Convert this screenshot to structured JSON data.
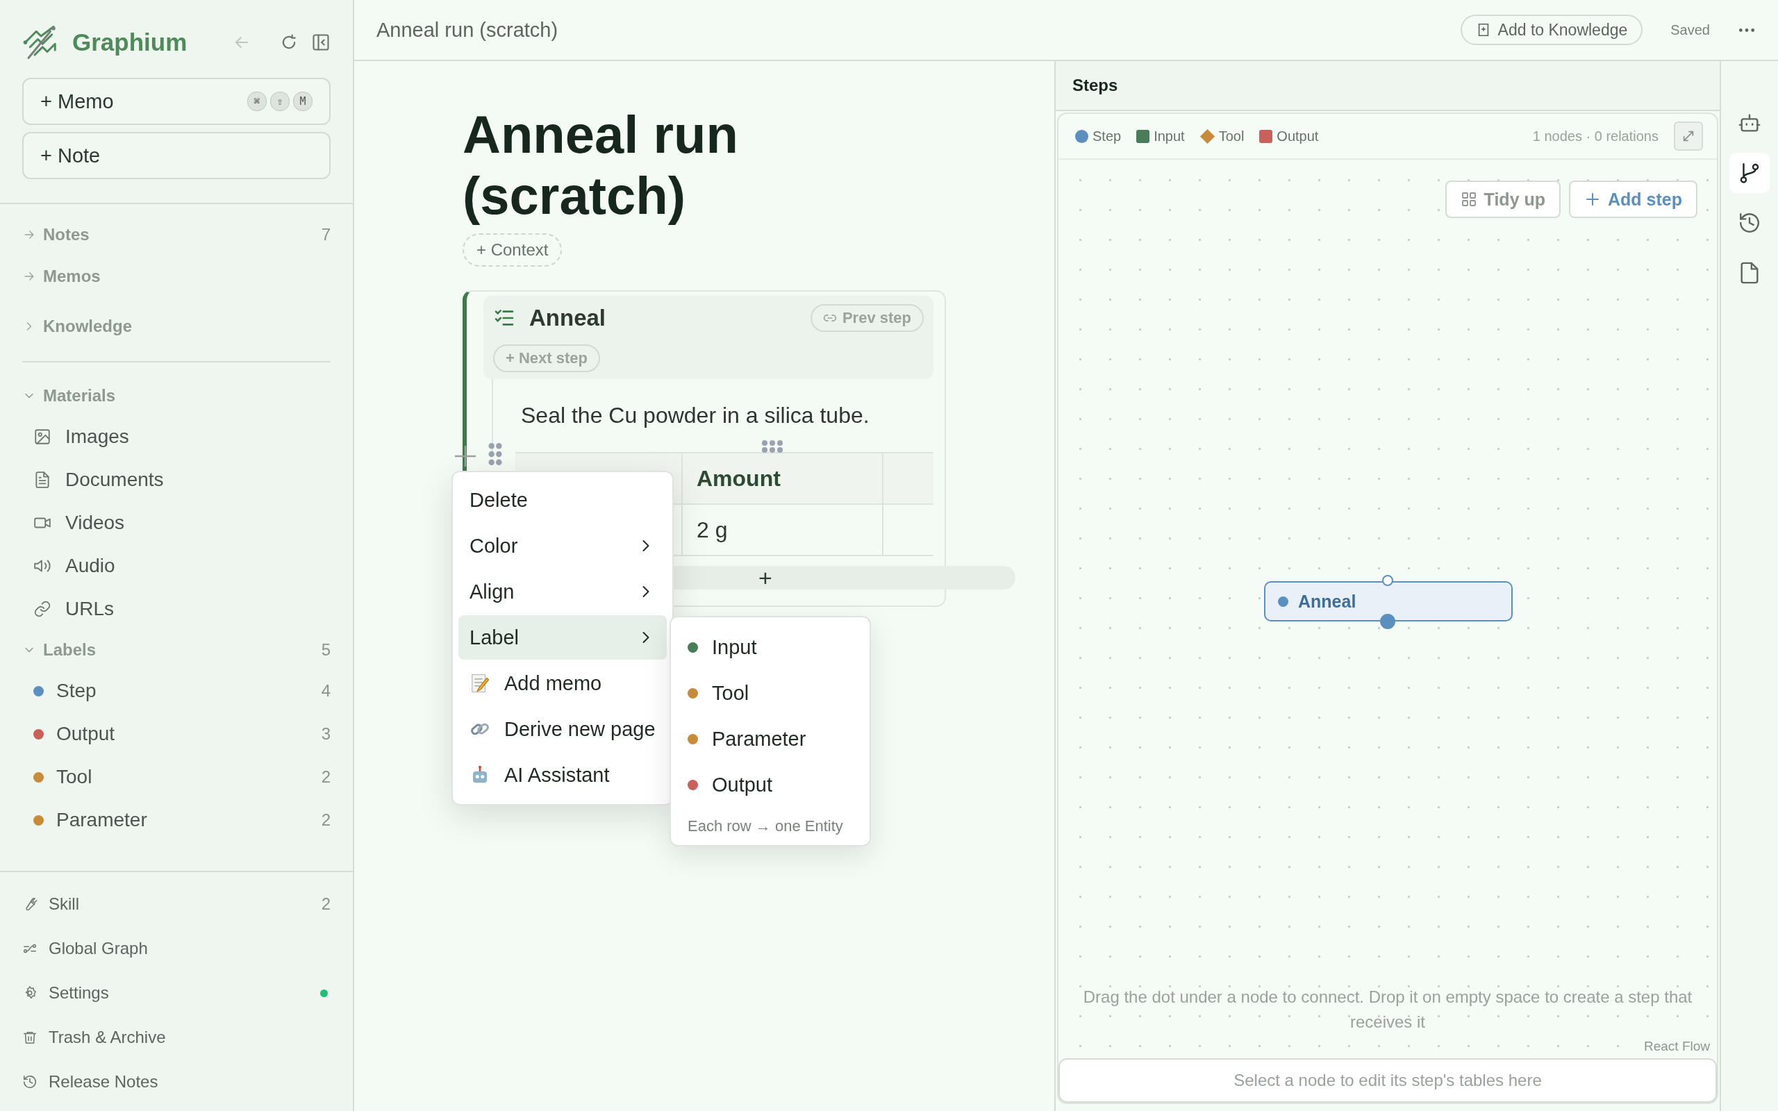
{
  "app": {
    "name": "Graphium"
  },
  "sidebar": {
    "actions": [
      {
        "label": "+ Memo",
        "shortcut": [
          "⌘",
          "⇧",
          "M"
        ]
      },
      {
        "label": "+ Note"
      }
    ],
    "nav": [
      {
        "label": "Notes",
        "count": "7",
        "kind": "link"
      },
      {
        "label": "Memos",
        "kind": "link"
      },
      {
        "label": "Knowledge",
        "kind": "group",
        "expanded": false
      }
    ],
    "materials": {
      "label": "Materials",
      "expanded": true,
      "items": [
        {
          "label": "Images",
          "kind": "image"
        },
        {
          "label": "Documents",
          "kind": "document"
        },
        {
          "label": "Videos",
          "kind": "video"
        },
        {
          "label": "Audio",
          "kind": "audio"
        },
        {
          "label": "URLs",
          "kind": "link"
        }
      ]
    },
    "labels": {
      "label": "Labels",
      "count": "5",
      "expanded": true,
      "items": [
        {
          "label": "Step",
          "count": "4",
          "color": "#5b8fc0"
        },
        {
          "label": "Output",
          "count": "3",
          "color": "#c9605a"
        },
        {
          "label": "Tool",
          "count": "2",
          "color": "#c98b3a"
        },
        {
          "label": "Parameter",
          "count": "2",
          "color": "#c98b3a"
        }
      ]
    },
    "footer": [
      {
        "label": "Skill",
        "count": "2",
        "kind": "skill",
        "notification": false
      },
      {
        "label": "Global Graph",
        "kind": "graph",
        "notification": false
      },
      {
        "label": "Settings",
        "kind": "settings",
        "notification": true
      },
      {
        "label": "Trash & Archive",
        "kind": "trash",
        "notification": false
      },
      {
        "label": "Release Notes",
        "kind": "history",
        "notification": false
      }
    ]
  },
  "header": {
    "title": "Anneal run (scratch)",
    "add_button": "Add to Knowledge",
    "status": "Saved"
  },
  "document": {
    "title": "Anneal run (scratch)",
    "context_button": "+ Context",
    "step": {
      "title": "Anneal",
      "prev_button": "Prev step",
      "next_button": "+ Next step",
      "text": "Seal the Cu powder in a silica tube.",
      "table": {
        "columns": [
          "Amount"
        ],
        "rows": [
          [
            "2 g"
          ]
        ],
        "add_row": "+"
      }
    }
  },
  "context_menu": {
    "items": [
      {
        "label": "Delete",
        "kind": "plain",
        "selected": false
      },
      {
        "label": "Color",
        "kind": "submenu",
        "selected": false
      },
      {
        "label": "Align",
        "kind": "submenu",
        "selected": false
      },
      {
        "label": "Label",
        "kind": "submenu",
        "selected": true
      },
      {
        "label": "Add memo",
        "kind": "memo",
        "selected": false
      },
      {
        "label": "Derive new page",
        "kind": "link",
        "selected": false
      },
      {
        "label": "AI Assistant",
        "kind": "robot",
        "selected": false
      }
    ]
  },
  "label_submenu": {
    "items": [
      {
        "label": "Input",
        "color": "#4a7c59"
      },
      {
        "label": "Tool",
        "color": "#c98b3a"
      },
      {
        "label": "Parameter",
        "color": "#c98b3a"
      },
      {
        "label": "Output",
        "color": "#c9605a"
      }
    ],
    "hint": "Each row → one Entity"
  },
  "steps_panel": {
    "title": "Steps",
    "legend": [
      {
        "label": "Step",
        "kind": "circle",
        "color": "#5b8fc0"
      },
      {
        "label": "Input",
        "kind": "square",
        "color": "#4a7c59"
      },
      {
        "label": "Tool",
        "kind": "diamond",
        "color": "#c98b3a"
      },
      {
        "label": "Output",
        "kind": "square",
        "color": "#c9605a"
      }
    ],
    "stats": "1 nodes · 0 relations",
    "tidy_button": "Tidy up",
    "add_button": "Add step",
    "nodes": [
      {
        "label": "Anneal",
        "color": "#5b8fc0"
      }
    ],
    "hint": "Drag the dot under a node to connect. Drop it on empty space to create a step that receives it",
    "attribution": "React Flow",
    "editor_placeholder": "Select a node to edit its step's tables here"
  },
  "right_rail": [
    {
      "kind": "robot",
      "selected": false
    },
    {
      "kind": "branch",
      "selected": true
    },
    {
      "kind": "history",
      "selected": false
    },
    {
      "kind": "document",
      "selected": false
    }
  ]
}
